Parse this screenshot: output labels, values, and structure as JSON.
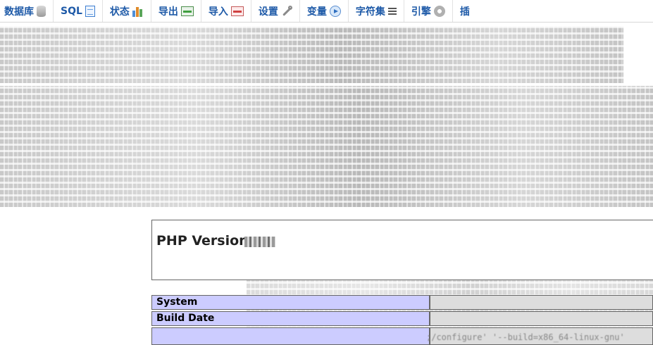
{
  "toolbar": {
    "tabs": [
      {
        "label": "数据库",
        "icon": "database-icon"
      },
      {
        "label": "SQL",
        "icon": "sql-icon"
      },
      {
        "label": "状态",
        "icon": "status-icon"
      },
      {
        "label": "导出",
        "icon": "export-icon"
      },
      {
        "label": "导入",
        "icon": "import-icon"
      },
      {
        "label": "设置",
        "icon": "wrench-icon"
      },
      {
        "label": "变量",
        "icon": "variables-icon"
      },
      {
        "label": "字符集",
        "icon": "charset-icon"
      },
      {
        "label": "引擎",
        "icon": "engine-icon"
      },
      {
        "label": "插",
        "icon": ""
      }
    ]
  },
  "phpinfo": {
    "title": "PHP Version",
    "rows": [
      {
        "label": "System"
      },
      {
        "label": "Build Date"
      }
    ],
    "configure_text": ";/configure' '--build=x86_64-linux-gnu'"
  }
}
